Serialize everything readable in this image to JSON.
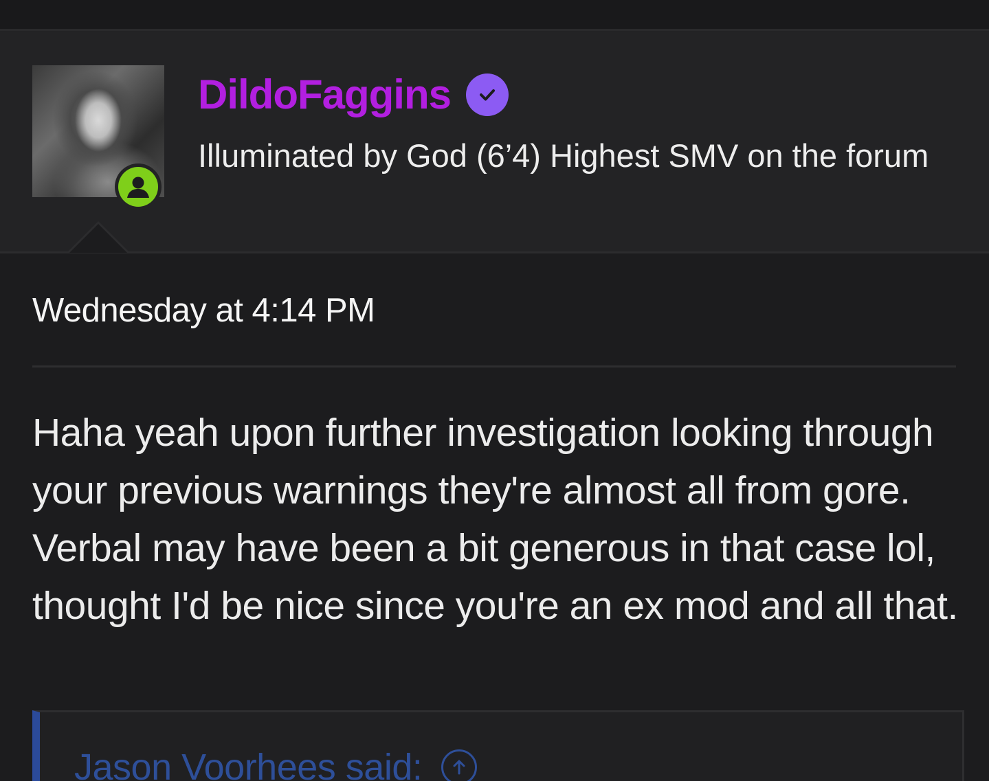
{
  "user": {
    "name": "DildoFaggins",
    "title": "Illuminated by God (6’4) Highest SMV on the forum",
    "name_color": "#b21fe0",
    "verified_color": "#8c5bf3",
    "online_color": "#7fcf1a",
    "avatar_icon": "user-avatar-photo",
    "online_icon": "user-circle-icon",
    "verified_icon": "check-circle-icon"
  },
  "post": {
    "timestamp": "Wednesday at 4:14 PM",
    "body": "Haha yeah upon further investigation looking through your previous warnings they're almost all from gore. Verbal may have been a bit generous in that case lol, thought I'd be nice since you're an ex mod and all that."
  },
  "quote": {
    "author_label": "Jason Voorhees said:",
    "accent_color": "#2b4a9a",
    "jump_icon": "arrow-up-circle-icon"
  }
}
